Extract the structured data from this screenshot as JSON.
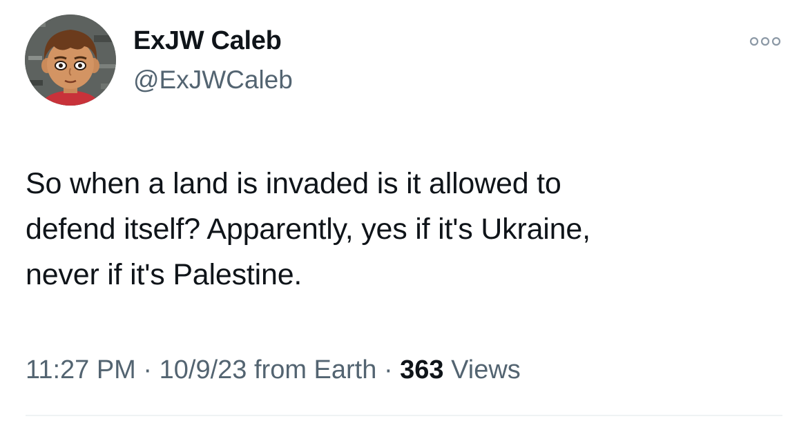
{
  "author": {
    "display_name": "ExJW Caleb",
    "handle": "@ExJWCaleb",
    "avatar_icon": "cartoon-avatar-icon"
  },
  "tweet": {
    "lines": [
      "So when a land is invaded is it allowed to",
      "defend itself? Apparently, yes if it's Ukraine,",
      "never if it's Palestine."
    ]
  },
  "meta": {
    "time": "11:27 PM",
    "separator": "·",
    "date": "10/9/23",
    "source": "from Earth",
    "views_count": "363",
    "views_label": "Views"
  },
  "colors": {
    "text_primary": "#0f1419",
    "text_secondary": "#536471",
    "divider": "#eff3f4",
    "more_dots": "#8b98a5"
  }
}
